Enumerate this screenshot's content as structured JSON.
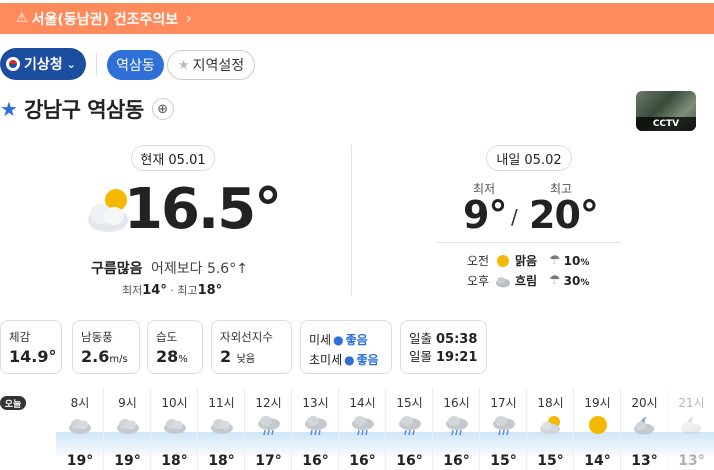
{
  "alert": {
    "icon": "warning-icon",
    "text": "서울(동남권) 건조주의보",
    "chevron": "›"
  },
  "toolbar": {
    "source_label": "기상청",
    "location_chip": "역삼동",
    "settings_chip": "지역설정"
  },
  "location": {
    "name": "강남구 역삼동",
    "cctv_label": "CCTV"
  },
  "current": {
    "date_label": "현재 05.01",
    "icon": "partly-cloudy-icon",
    "temperature": "16.5°",
    "condition": "구름많음",
    "comparison": "어제보다 5.6°↑",
    "min_label": "최저",
    "min_value": "14°",
    "max_label": "최고",
    "max_value": "18°",
    "separator": "·"
  },
  "tomorrow": {
    "date_label": "내일 05.02",
    "min_label": "최저",
    "max_label": "최고",
    "min_value": "9°",
    "max_value": "20°",
    "slash": "/",
    "am": {
      "label": "오전",
      "icon": "sun-icon",
      "condition": "맑음",
      "rain_icon": "umbrella-icon",
      "pop": "10",
      "unit": "%"
    },
    "pm": {
      "label": "오후",
      "icon": "cloud-icon",
      "condition": "흐림",
      "rain_icon": "umbrella-icon",
      "pop": "30",
      "unit": "%"
    }
  },
  "details": {
    "feels": {
      "label": "체감",
      "value": "14.9°"
    },
    "wind": {
      "label": "남동풍",
      "value": "2.6",
      "unit": "m/s"
    },
    "humidity": {
      "label": "습도",
      "value": "28",
      "unit": "%"
    },
    "uv": {
      "label": "자외선지수",
      "value": "2",
      "unit": "낮음"
    },
    "dust": {
      "pm10_label": "미세",
      "pm10_value": "좋음",
      "pm25_label": "초미세",
      "pm25_value": "좋음"
    },
    "sun": {
      "rise_label": "일출",
      "rise_time": "05:38",
      "set_label": "일몰",
      "set_time": "19:21"
    }
  },
  "hourly": {
    "today_badge": "오늘",
    "items": [
      {
        "time": "8시",
        "icon": "cloud-icon",
        "temp": "19°"
      },
      {
        "time": "9시",
        "icon": "cloud-icon",
        "temp": "19°"
      },
      {
        "time": "10시",
        "icon": "cloud-icon",
        "temp": "18°"
      },
      {
        "time": "11시",
        "icon": "cloud-icon",
        "temp": "18°"
      },
      {
        "time": "12시",
        "icon": "rain-icon",
        "temp": "17°"
      },
      {
        "time": "13시",
        "icon": "rain-icon",
        "temp": "16°"
      },
      {
        "time": "14시",
        "icon": "rain-icon",
        "temp": "16°"
      },
      {
        "time": "15시",
        "icon": "rain-icon",
        "temp": "16°"
      },
      {
        "time": "16시",
        "icon": "rain-icon",
        "temp": "16°"
      },
      {
        "time": "17시",
        "icon": "rain-icon",
        "temp": "15°"
      },
      {
        "time": "18시",
        "icon": "partly-cloudy-icon",
        "temp": "15°"
      },
      {
        "time": "19시",
        "icon": "sun-icon",
        "temp": "14°"
      },
      {
        "time": "20시",
        "icon": "cloud-night-icon",
        "temp": "13°"
      },
      {
        "time": "21시",
        "icon": "cloud-night-icon",
        "temp": "13°"
      }
    ]
  },
  "colors": {
    "alert": "#ff8a5b",
    "brand": "#1c4ea0",
    "accent": "#2e6fd8"
  }
}
